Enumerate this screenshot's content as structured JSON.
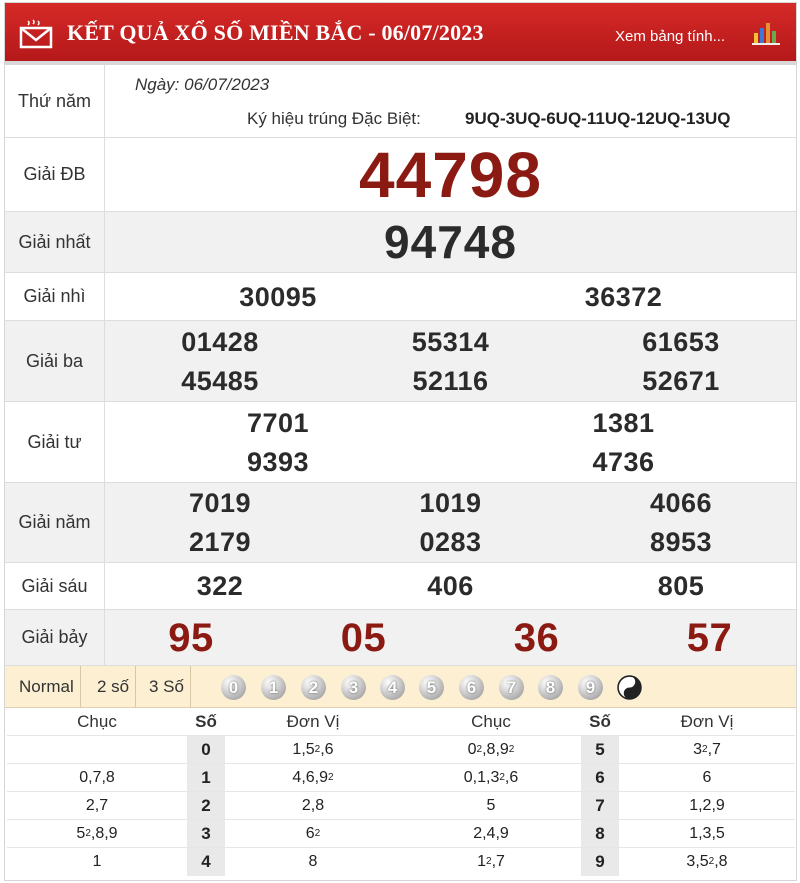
{
  "header": {
    "title": "KẾT QUẢ XỔ SỐ MIỀN BẮC - 06/07/2023",
    "xem_link": "Xem bảng tính..."
  },
  "info": {
    "weekday": "Thứ năm",
    "date": "Ngày: 06/07/2023",
    "symbol_label": "Ký hiệu trúng Đặc Biệt:",
    "symbol": "9UQ-3UQ-6UQ-11UQ-12UQ-13UQ"
  },
  "prizes": {
    "db": {
      "label": "Giải ĐB",
      "numbers": [
        "44798"
      ]
    },
    "nhat": {
      "label": "Giải nhất",
      "numbers": [
        "94748"
      ]
    },
    "nhi": {
      "label": "Giải nhì",
      "numbers": [
        "30095",
        "36372"
      ]
    },
    "ba": {
      "label": "Giải ba",
      "numbers": [
        "01428",
        "55314",
        "61653",
        "45485",
        "52116",
        "52671"
      ]
    },
    "tu": {
      "label": "Giải tư",
      "numbers": [
        "7701",
        "1381",
        "9393",
        "4736"
      ]
    },
    "nam": {
      "label": "Giải năm",
      "numbers": [
        "7019",
        "1019",
        "4066",
        "2179",
        "0283",
        "8953"
      ]
    },
    "sau": {
      "label": "Giải sáu",
      "numbers": [
        "322",
        "406",
        "805"
      ]
    },
    "bay": {
      "label": "Giải bảy",
      "numbers": [
        "95",
        "05",
        "36",
        "57"
      ]
    }
  },
  "toolbar": {
    "modes": [
      "Normal",
      "2 số",
      "3 Số"
    ],
    "digits": [
      "0",
      "1",
      "2",
      "3",
      "4",
      "5",
      "6",
      "7",
      "8",
      "9"
    ]
  },
  "loto": {
    "headers": {
      "chuc": "Chục",
      "so": "Số",
      "donvi": "Đơn Vị"
    },
    "left": [
      {
        "chuc": "",
        "so": "0",
        "donvi": "1,5<sup>2</sup>,6"
      },
      {
        "chuc": "0,7,8",
        "so": "1",
        "donvi": "4,6,9<sup>2</sup>"
      },
      {
        "chuc": "2,7",
        "so": "2",
        "donvi": "2,8"
      },
      {
        "chuc": "5<sup>2</sup>,8,9",
        "so": "3",
        "donvi": "6<sup>2</sup>"
      },
      {
        "chuc": "1",
        "so": "4",
        "donvi": "8"
      }
    ],
    "right": [
      {
        "chuc": "0<sup>2</sup>,8,9<sup>2</sup>",
        "so": "5",
        "donvi": "3<sup>2</sup>,7"
      },
      {
        "chuc": "0,1,3<sup>2</sup>,6",
        "so": "6",
        "donvi": "6"
      },
      {
        "chuc": "5",
        "so": "7",
        "donvi": "1,2,9"
      },
      {
        "chuc": "2,4,9",
        "so": "8",
        "donvi": "1,3,5"
      },
      {
        "chuc": "1<sup>2</sup>,7",
        "so": "9",
        "donvi": "3,5<sup>2</sup>,8"
      }
    ]
  },
  "colors": {
    "header_red": "#c62120",
    "prize_red": "#8b1a12",
    "toolbar_bg": "#fcefd2"
  }
}
